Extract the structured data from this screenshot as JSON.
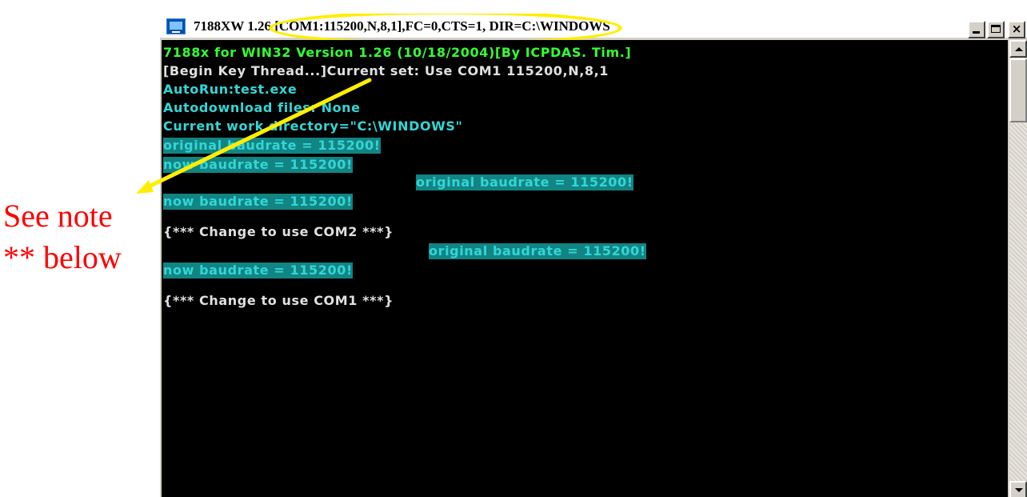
{
  "window": {
    "title": "7188XW 1.26 [COM1:115200,N,8,1],FC=0,CTS=1, DIR=C:\\WINDOWS",
    "minimize_label": "_",
    "close_label": "×"
  },
  "annotation": {
    "line1": "See note",
    "line2": "** below"
  },
  "console": {
    "lines": [
      "7188x for WIN32 Version 1.26 (10/18/2004)[By ICPDAS. Tim.]",
      "[Begin Key Thread...]Current set: Use COM1 115200,N,8,1",
      "AutoRun:test.exe",
      "Autodownload files: None",
      "Current work directory=\"C:\\WINDOWS\"",
      "original baudrate = 115200!",
      "now baudrate = 115200!",
      "original baudrate = 115200!",
      "now baudrate = 115200!",
      "{*** Change to use COM2 ***}",
      "original baudrate = 115200!",
      "now baudrate = 115200!",
      "{*** Change to use COM1 ***}"
    ]
  },
  "colors": {
    "terminal_bg": "#000000",
    "green_text": "#33ff33",
    "cyan_text": "#33d6d6",
    "highlight_bg": "#138484",
    "annotation": "#ff0000",
    "callout": "#ffee00"
  }
}
